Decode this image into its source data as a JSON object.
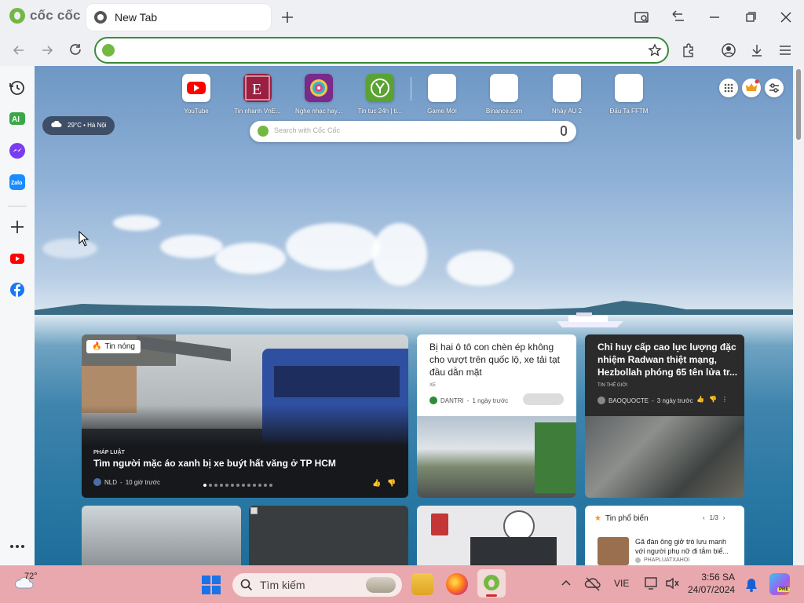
{
  "browser": {
    "brand": "cốc cốc",
    "tab_title": "New Tab",
    "omnibox_value": ""
  },
  "newtab": {
    "quick_links": [
      {
        "label": "YouTube",
        "icon": "youtube-icon"
      },
      {
        "label": "Tin nhanh VnE...",
        "icon": "vnexpress-icon"
      },
      {
        "label": "Nghe nhạc hay...",
        "icon": "music-icon"
      },
      {
        "label": "Tin tuc 24h | ti...",
        "icon": "24h-icon"
      },
      {
        "label": "Game Mới",
        "icon": "blank-icon"
      },
      {
        "label": "Binance.com",
        "icon": "blank-icon"
      },
      {
        "label": "Nhảy AU 2",
        "icon": "blank-icon"
      },
      {
        "label": "Đấu Ta FFTM",
        "icon": "blank-icon"
      }
    ],
    "weather": "29°C • Hà Nội",
    "search_placeholder": "Search with Cốc Cốc"
  },
  "news": {
    "hot": {
      "badge": "Tin nóng",
      "category": "PHÁP LUẬT",
      "title": "Tìm người mặc áo xanh bị xe buýt hất văng ở TP HCM",
      "source": "NLD",
      "time": "10 giờ trước"
    },
    "card2": {
      "title": "Bị hai ô tô con chèn ép không cho vượt trên quốc lộ, xe tải tạt đầu dằn mặt",
      "category": "XE",
      "source": "DANTRI",
      "time": "1 ngày trước"
    },
    "card3": {
      "title": "Chỉ huy cấp cao lực lượng đặc nhiệm Radwan thiệt mạng, Hezbollah phóng 65 tên lửa tr...",
      "category": "TIN THẾ GIỚI",
      "source": "BAOQUOCTE",
      "time": "3 ngày trước"
    },
    "popular": {
      "header": "Tin phổ biến",
      "pager": "1/3",
      "item_title": "Gã đàn ông giở trò lưu manh với người phụ nữ đi tắm biể...",
      "item_source": "PHAPLUATXAHOI"
    }
  },
  "taskbar": {
    "weather_temp": "72°",
    "search_label": "Tìm kiếm",
    "language": "VIE",
    "time": "3:56 SA",
    "date": "24/07/2024"
  },
  "colors": {
    "accent_green": "#74b844",
    "omnibox_border": "#3a8a3a",
    "taskbar_bg": "#e9a8ad"
  }
}
